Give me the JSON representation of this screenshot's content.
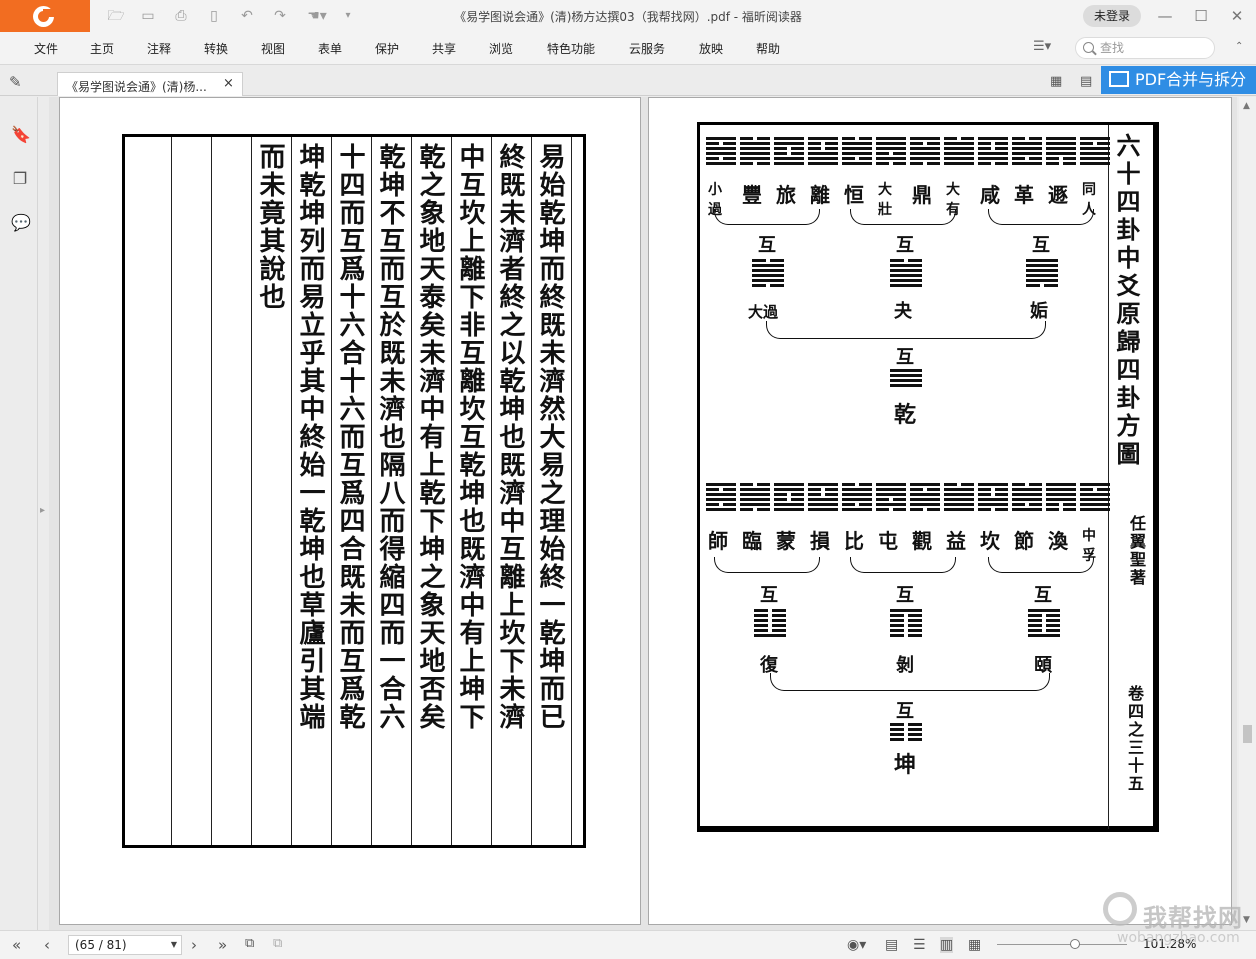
{
  "window": {
    "title": "《易学图说会通》(清)杨方达撰03（我帮找网）.pdf - 福昕阅读器",
    "login_label": "未登录",
    "accent_color": "#f26d21"
  },
  "menu": {
    "items": [
      "文件",
      "主页",
      "注释",
      "转换",
      "视图",
      "表单",
      "保护",
      "共享",
      "浏览",
      "特色功能",
      "云服务",
      "放映",
      "帮助"
    ],
    "search_placeholder": "查找"
  },
  "tab": {
    "label": "《易学图说会通》(清)杨...",
    "close": "×",
    "promo_label": "PDF合并与拆分"
  },
  "left_page": {
    "columns": [
      "易始乾坤而終既未濟然大易之理始終一乾坤而已",
      "終既未濟者終之以乾坤也既濟中互離上坎下未濟",
      "中互坎上離下非互離坎互乾坤也既濟中有上坤下",
      "乾之象地天泰矣未濟中有上乾下坤之象天地否矣",
      "乾坤不互而互於既未濟也隔八而得縮四而一合六",
      "十四而互爲十六合十六而互爲四合既未而互爲乾",
      "坤乾坤列而易立乎其中終始一乾坤也草廬引其端",
      "而未竟其說也"
    ]
  },
  "right_page": {
    "title": "六十四卦中爻原歸四卦方圖",
    "author": "任翼聖著",
    "folio": "卷四之三十五",
    "hu_label": "互",
    "top_row": [
      "小過",
      "豐",
      "旅",
      "離",
      "恒",
      "大壯",
      "鼎",
      "大有",
      "咸",
      "革",
      "遯",
      "同人"
    ],
    "top_results": [
      "大過",
      "夬",
      "姤"
    ],
    "top_final": "乾",
    "bottom_row": [
      "師",
      "臨",
      "蒙",
      "損",
      "比",
      "屯",
      "觀",
      "益",
      "坎",
      "節",
      "渙",
      "中孚"
    ],
    "bottom_results": [
      "復",
      "剝",
      "頤"
    ],
    "bottom_final": "坤"
  },
  "status": {
    "page_display": "(65 / 81)",
    "zoom": "101.28%"
  },
  "watermark": {
    "text": "我帮找网",
    "sub": "wobangzhao.com"
  }
}
